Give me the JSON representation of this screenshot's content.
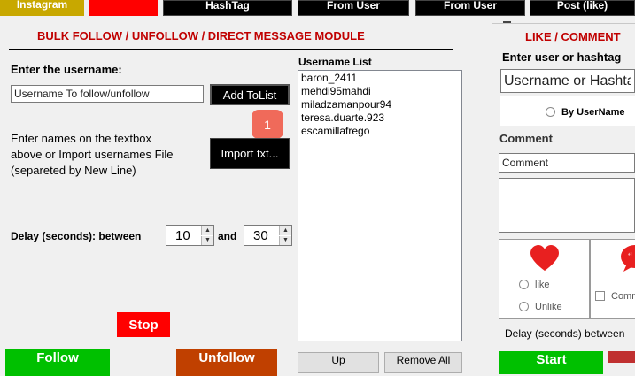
{
  "top_tabs": [
    {
      "label": "Instagram"
    },
    {
      "label": ""
    },
    {
      "label": "HashTag"
    },
    {
      "label": "From User"
    },
    {
      "label": "From User"
    },
    {
      "label": "Post (like)"
    }
  ],
  "follow_module": {
    "title": "BULK FOLLOW / UNFOLLOW / DIRECT MESSAGE MODULE",
    "username_label": "Enter the username:",
    "username_placeholder": "Username To follow/unfollow",
    "add_button": "Add ToList",
    "badge_count": "1",
    "instructions": [
      "Enter names on the textbox",
      "above or Import usernames File",
      "(separeted by New Line)"
    ],
    "import_button": "Import txt...",
    "delay_label": "Delay (seconds): between",
    "delay_from": "10",
    "delay_and": "and",
    "delay_to": "30",
    "stop_button": "Stop",
    "follow_button": "Follow",
    "unfollow_button": "Unfollow"
  },
  "username_list": {
    "header": "Username List",
    "items": [
      "baron_2411",
      "mehdi95mahdi",
      "miladzamanpour94",
      "teresa.duarte.923",
      "escamillafrego"
    ],
    "bottom_btn_1": "Up",
    "bottom_btn_2": "Remove All"
  },
  "like_module": {
    "title": "LIKE / COMMENT",
    "user_label": "Enter user or hashtag",
    "user_placeholder": "Username or Hashtag",
    "radio_by_username": "By UserName",
    "comment_label": "Comment",
    "comment_placeholder": "Comment",
    "like_option": "like",
    "unlike_option": "Unlike",
    "comment_option": "Comment",
    "delay_label": "Delay (seconds) between",
    "start_button": "Start"
  },
  "colors": {
    "accent_red": "#ff0000",
    "title_red": "#c00000",
    "yellow": "#c8a800",
    "green": "#00c000",
    "orange": "#c04000",
    "badge": "#f06a5a",
    "heart": "#e82020"
  }
}
